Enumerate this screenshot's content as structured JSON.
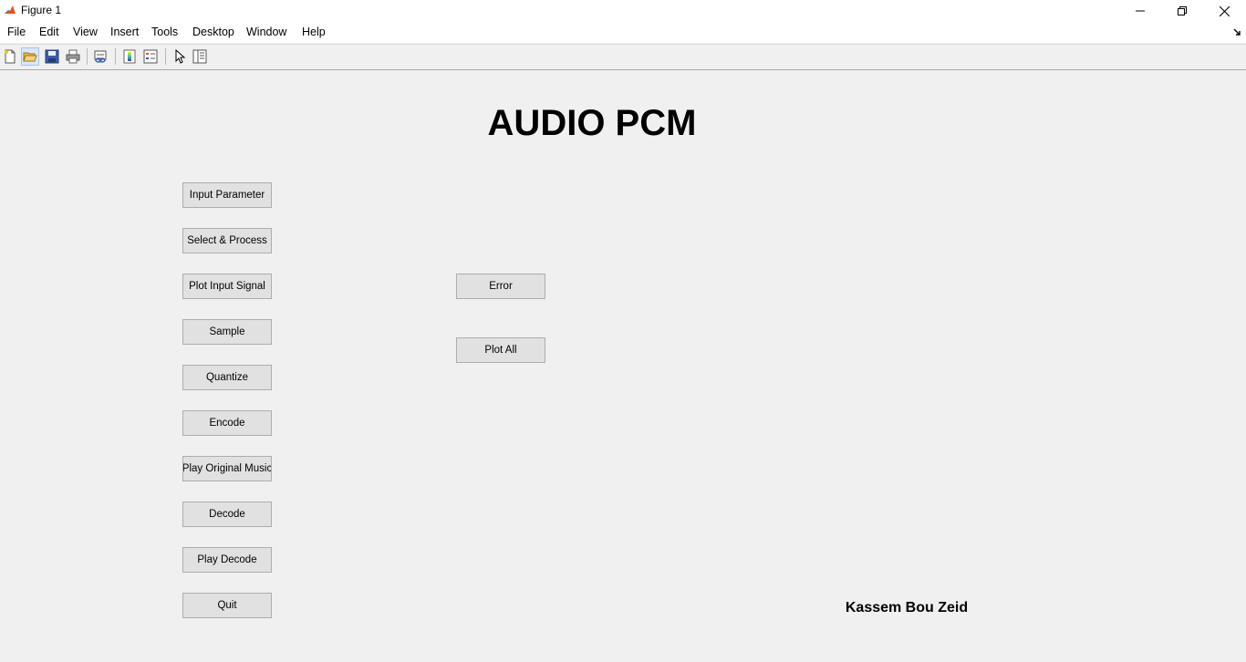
{
  "window": {
    "title": "Figure 1"
  },
  "menu": [
    "File",
    "Edit",
    "View",
    "Insert",
    "Tools",
    "Desktop",
    "Window",
    "Help"
  ],
  "toolbar": {
    "icons": [
      "new-figure-icon",
      "open-file-icon",
      "save-icon",
      "print-icon",
      "link-plot-icon",
      "insert-colorbar-icon",
      "insert-legend-icon",
      "edit-plot-icon",
      "property-inspector-icon"
    ],
    "active": "open-file-icon"
  },
  "main": {
    "heading": "AUDIO PCM",
    "left_buttons": [
      "Input Parameter",
      "Select & Process",
      "Plot Input Signal",
      "Sample",
      "Quantize",
      "Encode",
      "Play Original Music",
      "Decode",
      "Play Decode",
      "Quit"
    ],
    "right_buttons": [
      "Error",
      "Plot All"
    ],
    "author": "Kassem Bou Zeid"
  },
  "colors": {
    "background": "#f0f0f0",
    "button_face": "#e1e1e1",
    "button_border": "#adadad"
  }
}
